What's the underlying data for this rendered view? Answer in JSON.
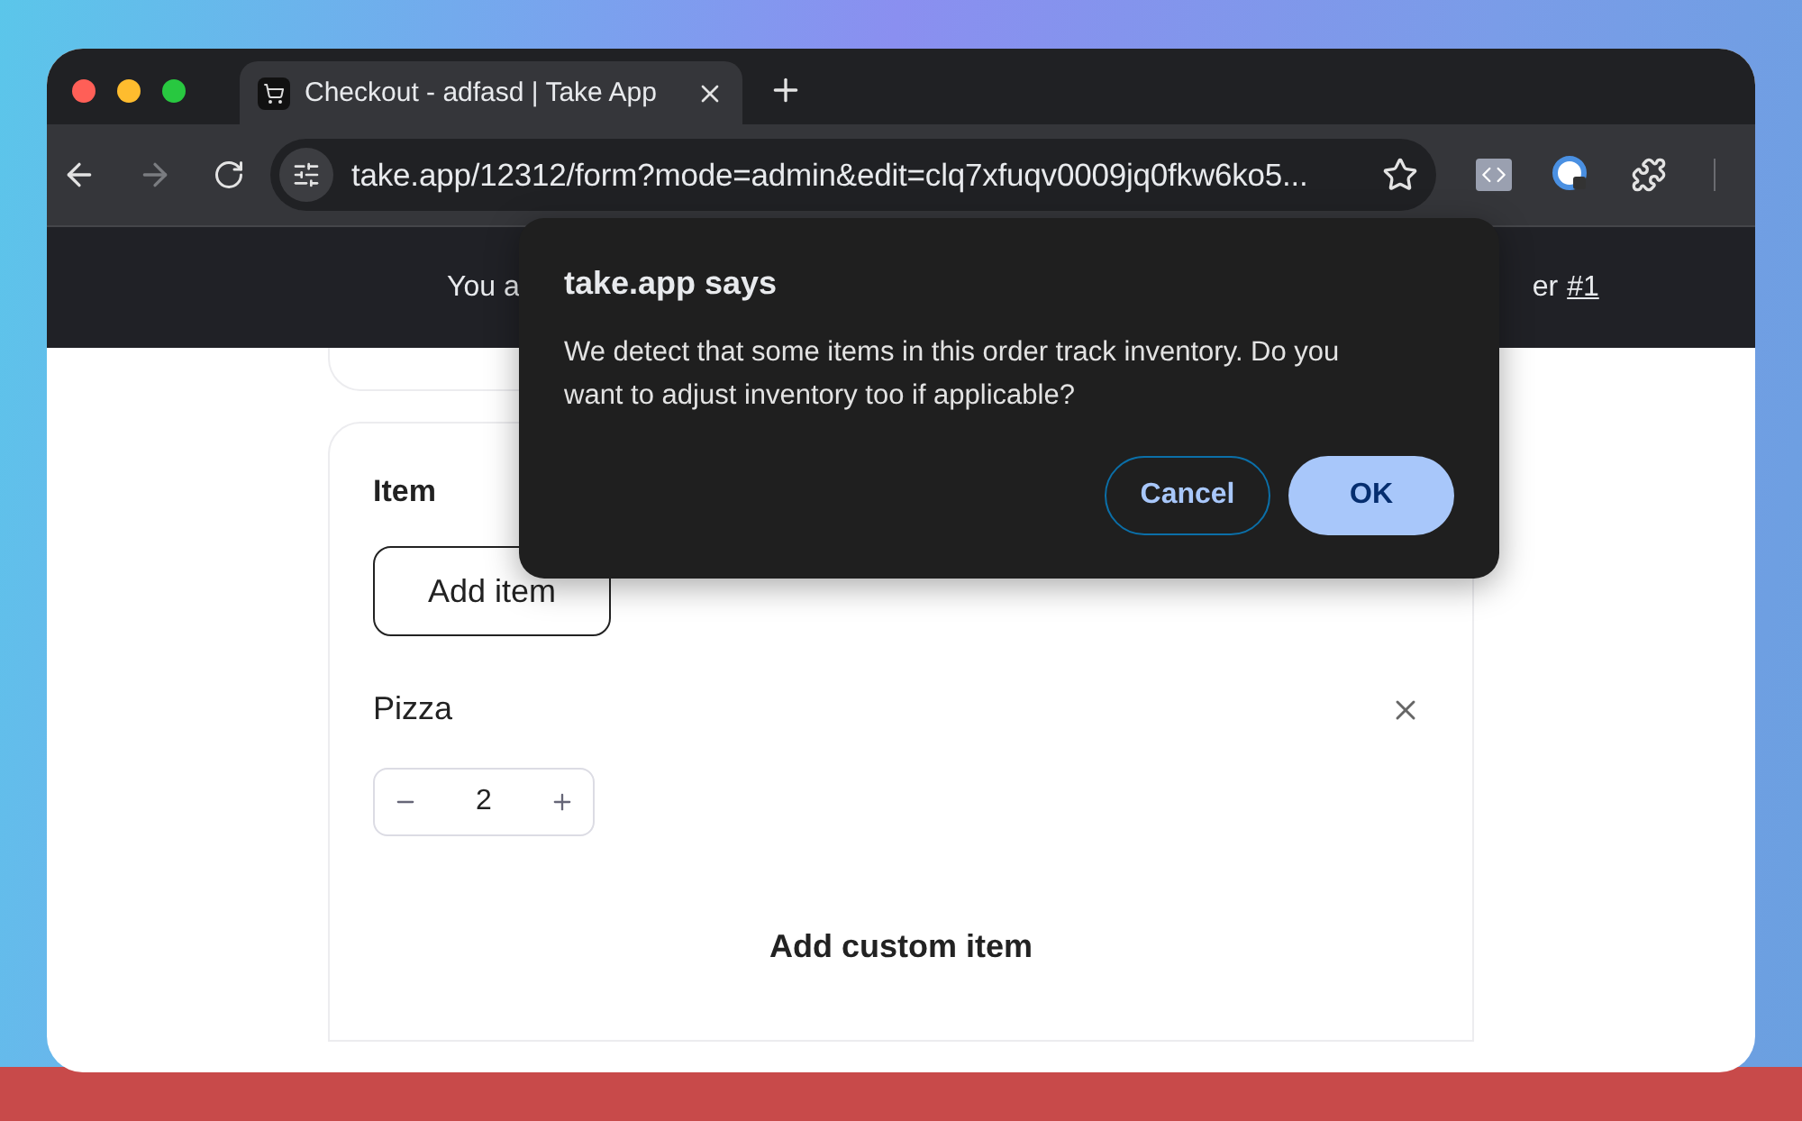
{
  "browser": {
    "tab": {
      "title": "Checkout - adfasd | Take App",
      "selected": true
    },
    "address": "take.app/12312/form?mode=admin&edit=clq7xfuqv0009jq0fkw6ko5..."
  },
  "banner": {
    "left": "You a",
    "right": "er",
    "link": "#1"
  },
  "order_items": {
    "heading": "Item",
    "add_button": "Add item",
    "items": [
      {
        "name": "Pizza",
        "quantity": "2"
      }
    ],
    "custom_button": "Add custom item"
  },
  "dialog": {
    "title": "take.app says",
    "message": "We detect that some items in this order track inventory. Do you want to adjust inventory too if applicable?",
    "buttons": [
      {
        "label": "Cancel",
        "kind": "secondary"
      },
      {
        "label": "OK",
        "kind": "primary"
      }
    ]
  }
}
